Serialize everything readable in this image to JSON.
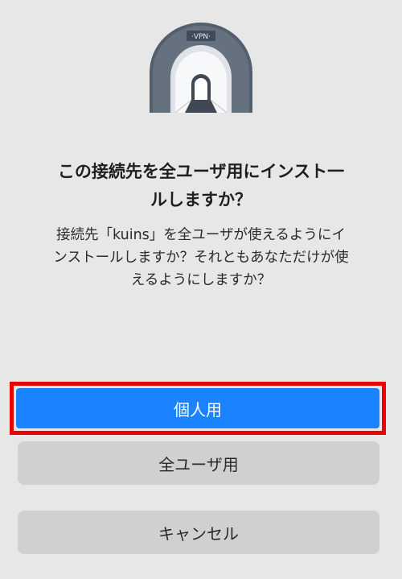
{
  "dialog": {
    "icon": "vpn-tunnel-icon",
    "icon_badge": "·VPN·",
    "title": "この接続先を全ユーザ用にインスト一\nルしますか？",
    "message": "接続先「kuins」を全ユーザが使えるようにイ\nンストールしますか？それともあなただけが使\nえるようにしますか？",
    "buttons": {
      "personal": "個人用",
      "all_users": "全ユーザ用",
      "cancel": "キャンセル"
    }
  },
  "colors": {
    "background": "#e7e7e7",
    "primary_button": "#1b83ff",
    "secondary_button": "#d0d0d0",
    "highlight": "#ee0000"
  }
}
